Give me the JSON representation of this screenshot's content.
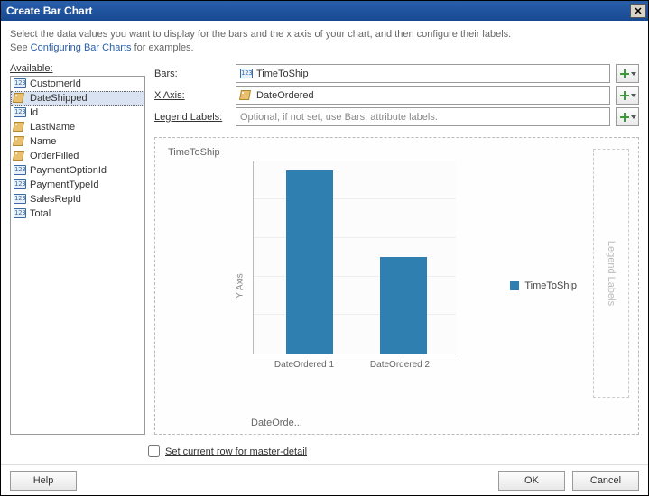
{
  "window": {
    "title": "Create Bar Chart"
  },
  "intro": {
    "line1": "Select the data values you want to display for the bars and the x axis of your chart, and then configure their labels.",
    "line2a": "See ",
    "link": "Configuring Bar Charts",
    "line2b": " for examples."
  },
  "available": {
    "label": "Available:",
    "items": [
      {
        "label": "CustomerId",
        "icon": "num",
        "selected": false
      },
      {
        "label": "DateShipped",
        "icon": "tag",
        "selected": true
      },
      {
        "label": "Id",
        "icon": "num",
        "selected": false
      },
      {
        "label": "LastName",
        "icon": "tag",
        "selected": false
      },
      {
        "label": "Name",
        "icon": "tag",
        "selected": false
      },
      {
        "label": "OrderFilled",
        "icon": "tag",
        "selected": false
      },
      {
        "label": "PaymentOptionId",
        "icon": "num",
        "selected": false
      },
      {
        "label": "PaymentTypeId",
        "icon": "num",
        "selected": false
      },
      {
        "label": "SalesRepId",
        "icon": "num",
        "selected": false
      },
      {
        "label": "Total",
        "icon": "num",
        "selected": false
      }
    ]
  },
  "config": {
    "bars": {
      "label": "Bars:",
      "value": "TimeToShip",
      "icon": "num"
    },
    "xaxis": {
      "label": "X Axis:",
      "value": "DateOrdered",
      "icon": "tag"
    },
    "legend": {
      "label": "Legend Labels:",
      "placeholder": "Optional; if not set, use Bars: attribute labels."
    }
  },
  "preview": {
    "title": "TimeToShip",
    "yaxis": "Y Axis",
    "xaxis": "DateOrde...",
    "ticks": [
      "DateOrdered 1",
      "DateOrdered 2"
    ],
    "legend_strip": "Legend Labels",
    "legend_item": "TimeToShip"
  },
  "checkbox": {
    "label": "Set current row for master-detail",
    "checked": false
  },
  "buttons": {
    "help": "Help",
    "ok": "OK",
    "cancel": "Cancel"
  },
  "chart_data": {
    "type": "bar",
    "title": "TimeToShip",
    "categories": [
      "DateOrdered 1",
      "DateOrdered 2"
    ],
    "values": [
      95,
      50
    ],
    "xlabel": "DateOrdered",
    "ylabel": "Y Axis",
    "ylim": [
      0,
      100
    ],
    "series": [
      {
        "name": "TimeToShip",
        "values": [
          95,
          50
        ]
      }
    ]
  }
}
